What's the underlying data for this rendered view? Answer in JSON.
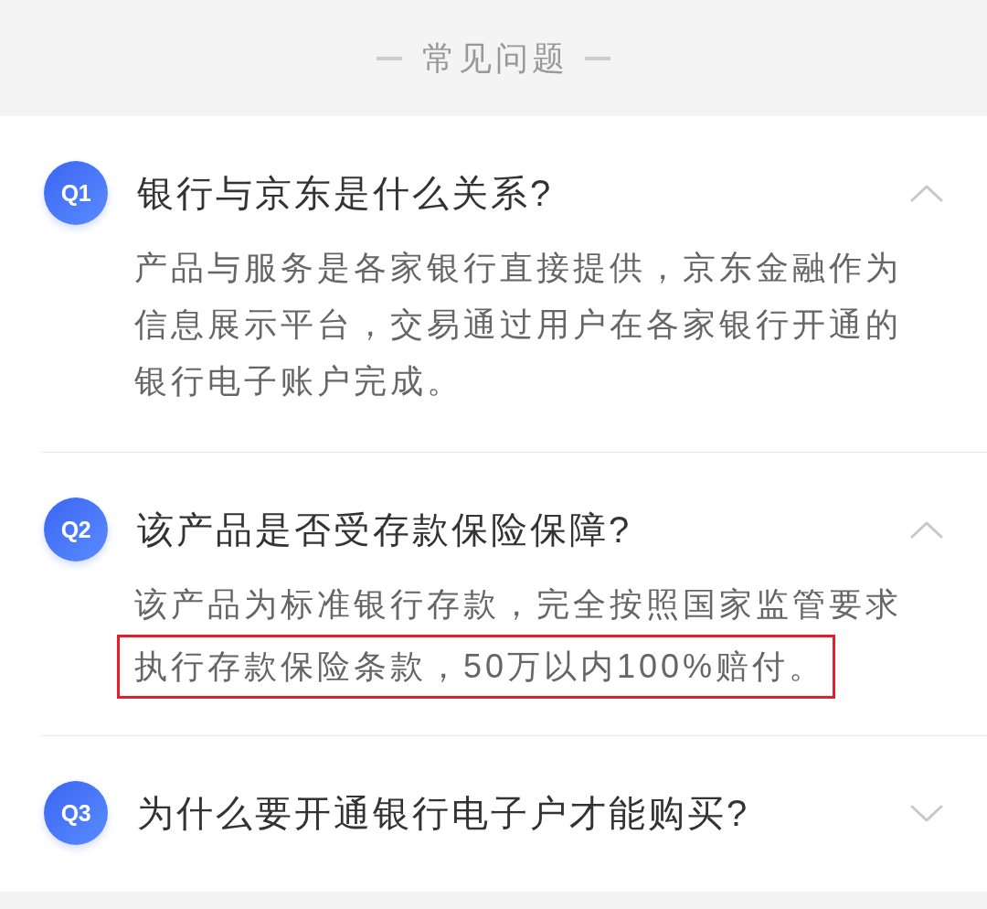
{
  "header": {
    "title": "常见问题"
  },
  "faq": [
    {
      "badge": "Q1",
      "question": "银行与京东是什么关系?",
      "expanded": true,
      "answer": [
        {
          "text": "产品与服务是各家银行直接提供，京东金融作为信息展示平台，交易通过用户在各家银行开通的银行电子账户完成。",
          "highlighted": false
        }
      ]
    },
    {
      "badge": "Q2",
      "question": "该产品是否受存款保险保障?",
      "expanded": true,
      "answer": [
        {
          "text": "该产品为标准银行存款，完全按照国家监管要求",
          "highlighted": false
        },
        {
          "text": "执行存款保险条款，50万以内100%赔付。",
          "highlighted": true
        }
      ]
    },
    {
      "badge": "Q3",
      "question": "为什么要开通银行电子户才能购买?",
      "expanded": false
    }
  ]
}
